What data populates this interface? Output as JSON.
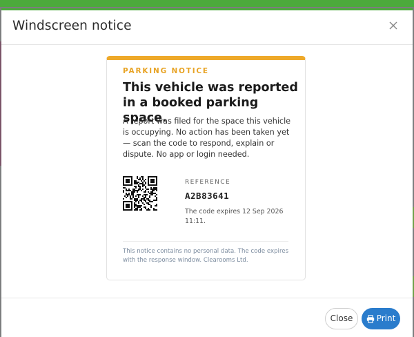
{
  "colors": {
    "accent_orange": "#eea92a",
    "primary_blue": "#2a7ccc",
    "success_green": "#4caa3c"
  },
  "modal": {
    "title": "Windscreen notice",
    "close_icon": "close-icon"
  },
  "notice": {
    "kicker": "PARKING NOTICE",
    "headline": "This vehicle was reported in a booked parking space.",
    "description": "A report was filed for the space this vehicle is occupying. No action has been taken yet — scan the code to respond, explain or dispute. No app or login needed.",
    "qr_icon": "qr-code-icon",
    "reference_label": "REFERENCE",
    "reference_code": "A2B83641",
    "expiry_text": "The code expires 12 Sep 2026 11:11.",
    "footnote": "This notice contains no personal data. The code expires with the response window. Clearooms Ltd."
  },
  "footer": {
    "close_label": "Close",
    "print_label": "Print",
    "print_icon": "printer-icon"
  }
}
